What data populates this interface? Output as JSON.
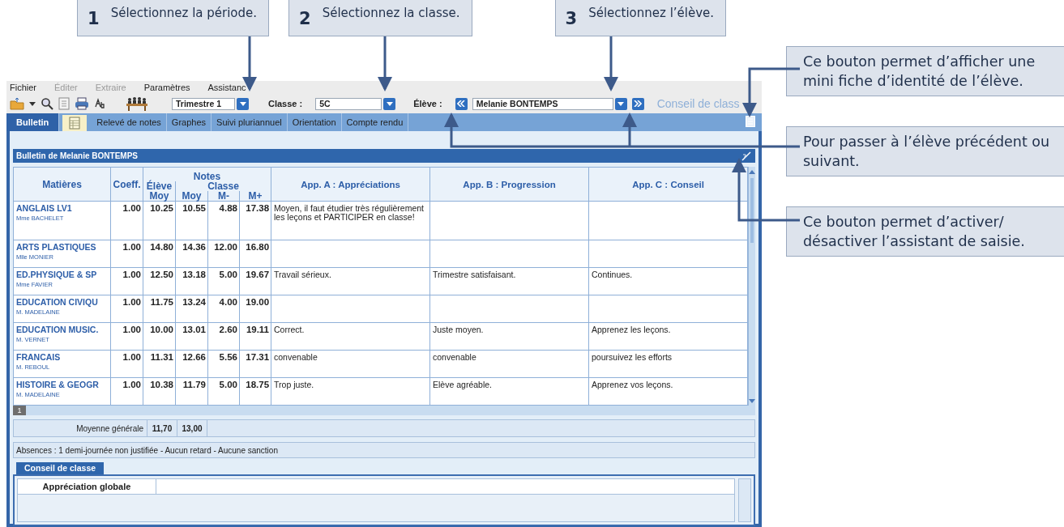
{
  "steps": [
    {
      "number": "1",
      "text": "Sélectionnez la période."
    },
    {
      "number": "2",
      "text": "Sélectionnez la classe."
    },
    {
      "number": "3",
      "text": "Sélectionnez l’élève."
    }
  ],
  "notes": [
    {
      "text": "Ce bouton permet d’afficher une mini fiche d’identité de l’élève."
    },
    {
      "text": "Pour passer à l’élève précédent ou suivant."
    },
    {
      "text": "Ce bouton permet d’activer/ désactiver l’assistant de saisie."
    }
  ],
  "menu": [
    {
      "label": "Fichier",
      "disabled": false
    },
    {
      "label": "Éditer",
      "disabled": true
    },
    {
      "label": "Extraire",
      "disabled": true
    },
    {
      "label": "Paramètres",
      "disabled": false
    },
    {
      "label": "Assistanc",
      "disabled": false
    }
  ],
  "toolbar": {
    "period": "Trimestre 1",
    "class_label": "Classe :",
    "class_value": "5C",
    "student_label": "Élève :",
    "student_value": "Melanie BONTEMPS",
    "mode_title": "Conseil de class"
  },
  "tabs": [
    {
      "label": "Bulletin",
      "selected": true
    },
    {
      "label": "Relevé de notes",
      "selected": false
    },
    {
      "label": "Graphes",
      "selected": false
    },
    {
      "label": "Suivi pluriannuel",
      "selected": false
    },
    {
      "label": "Orientation",
      "selected": false
    },
    {
      "label": "Compte rendu",
      "selected": false
    }
  ],
  "bulletin": {
    "title": "Bulletin de Melanie BONTEMPS",
    "columns": {
      "subject": "Matières",
      "coeff": "Coeff.",
      "notes": "Notes",
      "student": "Élève",
      "class": "Classe",
      "student_avg": "Moy",
      "class_avg": "Moy",
      "class_min": "M-",
      "class_max": "M+",
      "app_a": "App. A : Appréciations",
      "app_b": "App. B : Progression",
      "app_c": "App. C : Conseil"
    },
    "rows": [
      {
        "subject": "ANGLAIS LV1",
        "teacher": "Mme BACHELET",
        "coeff": "1.00",
        "student_avg": "10.25",
        "class_avg": "10.55",
        "class_min": "4.88",
        "class_max": "17.38",
        "app_a": "Moyen, il faut étudier très régulièrement les leçons et PARTICIPER en classe!"
      },
      {
        "subject": "ARTS PLASTIQUES",
        "teacher": "Mlle MONIER",
        "coeff": "1.00",
        "student_avg": "14.80",
        "class_avg": "14.36",
        "class_min": "12.00",
        "class_max": "16.80"
      },
      {
        "subject": "ED.PHYSIQUE & SP",
        "teacher": "Mme FAVIER",
        "coeff": "1.00",
        "student_avg": "12.50",
        "class_avg": "13.18",
        "class_min": "5.00",
        "class_max": "19.67",
        "app_a": "Travail sérieux.",
        "app_b": "Trimestre satisfaisant.",
        "app_c": "Continues."
      },
      {
        "subject": "EDUCATION CIVIQU",
        "teacher": "M. MADELAINE",
        "coeff": "1.00",
        "student_avg": "11.75",
        "class_avg": "13.24",
        "class_min": "4.00",
        "class_max": "19.00"
      },
      {
        "subject": "EDUCATION MUSIC.",
        "teacher": "M. VERNET",
        "coeff": "1.00",
        "student_avg": "10.00",
        "class_avg": "13.01",
        "class_min": "2.60",
        "class_max": "19.11",
        "app_a": "Correct.",
        "app_b": "Juste moyen.",
        "app_c": "Apprenez les leçons."
      },
      {
        "subject": "FRANCAIS",
        "teacher": "M. REBOUL",
        "coeff": "1.00",
        "student_avg": "11.31",
        "class_avg": "12.66",
        "class_min": "5.56",
        "class_max": "17.31",
        "app_a": "convenable",
        "app_b": "convenable",
        "app_c": "poursuivez les efforts"
      },
      {
        "subject": "HISTOIRE & GEOGR",
        "teacher": "M. MADELAINE",
        "coeff": "1.00",
        "student_avg": "10.38",
        "class_avg": "11.79",
        "class_min": "5.00",
        "class_max": "18.75",
        "app_a": "Trop juste.",
        "app_b": "Elève agréable.",
        "app_c": "Apprenez vos leçons."
      }
    ],
    "page": "1",
    "average_label": "Moyenne générale",
    "average_student": "11,70",
    "average_class": "13,00",
    "absences": "Absences : 1 demi-journée non justifiée - Aucun retard - Aucune sanction",
    "council_tab": "Conseil de classe",
    "global_label": "Appréciation globale"
  }
}
